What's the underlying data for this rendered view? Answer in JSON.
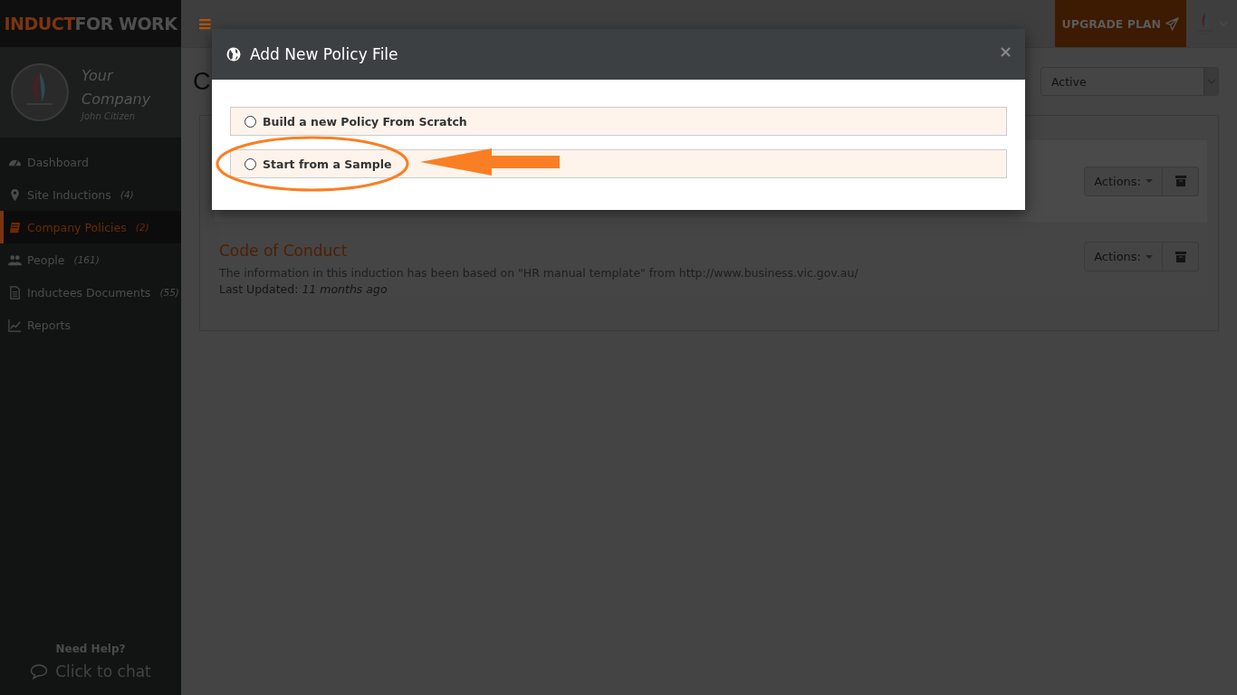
{
  "brand": {
    "part_1": "INDUCT",
    "part_2": "FOR WORK"
  },
  "profile": {
    "company": "Your Company",
    "user": "John Citizen"
  },
  "sidebar": {
    "items": [
      {
        "kind": "dashboard",
        "label": "Dashboard",
        "selected": false
      },
      {
        "kind": "pin",
        "label": "Site Inductions",
        "count": "(4)",
        "selected": false
      },
      {
        "kind": "book",
        "label": "Company Policies",
        "count": "(2)",
        "selected": true
      },
      {
        "kind": "people",
        "label": "People",
        "count": "(161)",
        "selected": false
      },
      {
        "kind": "document",
        "label": "Inductees Documents",
        "count": "(55)",
        "selected": false
      },
      {
        "kind": "chart",
        "label": "Reports",
        "selected": false
      }
    ]
  },
  "help": {
    "title": "Need Help?",
    "chat": "Click to chat"
  },
  "topbar": {
    "menu_icon": "≡",
    "upgrade": "UPGRADE PLAN"
  },
  "page_title": "C",
  "status_filter": {
    "value": "Active"
  },
  "policies": [
    {
      "highlighted": true,
      "actions": "Actions:"
    },
    {
      "highlighted": false,
      "title": "Code of Conduct",
      "description": "The information in this induction has been based on \"HR manual template\" from http://www.business.vic.gov.au/",
      "updated_label": "Last Updated:",
      "updated": "11 months ago",
      "actions": "Actions:"
    }
  ],
  "modal": {
    "title": "Add New Policy File",
    "close": "×",
    "options": [
      {
        "label": "Build a new Policy From Scratch",
        "selected": false
      },
      {
        "label": "Start from a Sample",
        "selected": false
      }
    ]
  }
}
